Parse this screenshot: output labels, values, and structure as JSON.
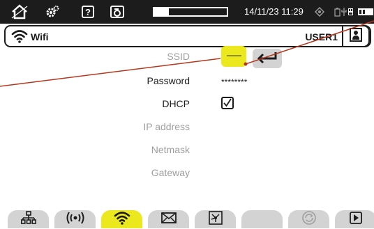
{
  "status_bar": {
    "datetime": "14/11/23 11:29",
    "progress": 0.2,
    "icons": [
      "home-icon",
      "settings-gears-icon",
      "help-icon",
      "screenshot-icon",
      "gps-icon",
      "power-battery-icon",
      "network-icon",
      "battery-icon"
    ],
    "help_glyph": "?"
  },
  "title_bar": {
    "title": "Wifi",
    "user": "USER1",
    "icons": [
      "wifi-icon",
      "user-profile-icon"
    ]
  },
  "form": {
    "ssid": {
      "label": "SSID",
      "value": "-------"
    },
    "password": {
      "label": "Password",
      "value": "********"
    },
    "dhcp": {
      "label": "DHCP",
      "checked": true
    },
    "ip_address": {
      "label": "IP address"
    },
    "netmask": {
      "label": "Netmask"
    },
    "gateway": {
      "label": "Gateway"
    }
  },
  "tabs": [
    {
      "icon": "ethernet-network-icon",
      "active": false
    },
    {
      "icon": "wireless-broadcast-icon",
      "active": false
    },
    {
      "icon": "wifi-icon",
      "active": true
    },
    {
      "icon": "email-icon",
      "active": false
    },
    {
      "icon": "network-topology-icon",
      "active": false
    },
    {
      "icon": "",
      "active": false
    },
    {
      "icon": "sync-icon",
      "active": false
    },
    {
      "icon": "play-icon",
      "active": false
    }
  ],
  "colors": {
    "accent_yellow": "#ECE81E",
    "status_bar_background": "#1C1C1C",
    "tab_grey": "#D3D3D3",
    "disabled_text": "#9E9E9E",
    "callout_line": "#B5361C"
  }
}
